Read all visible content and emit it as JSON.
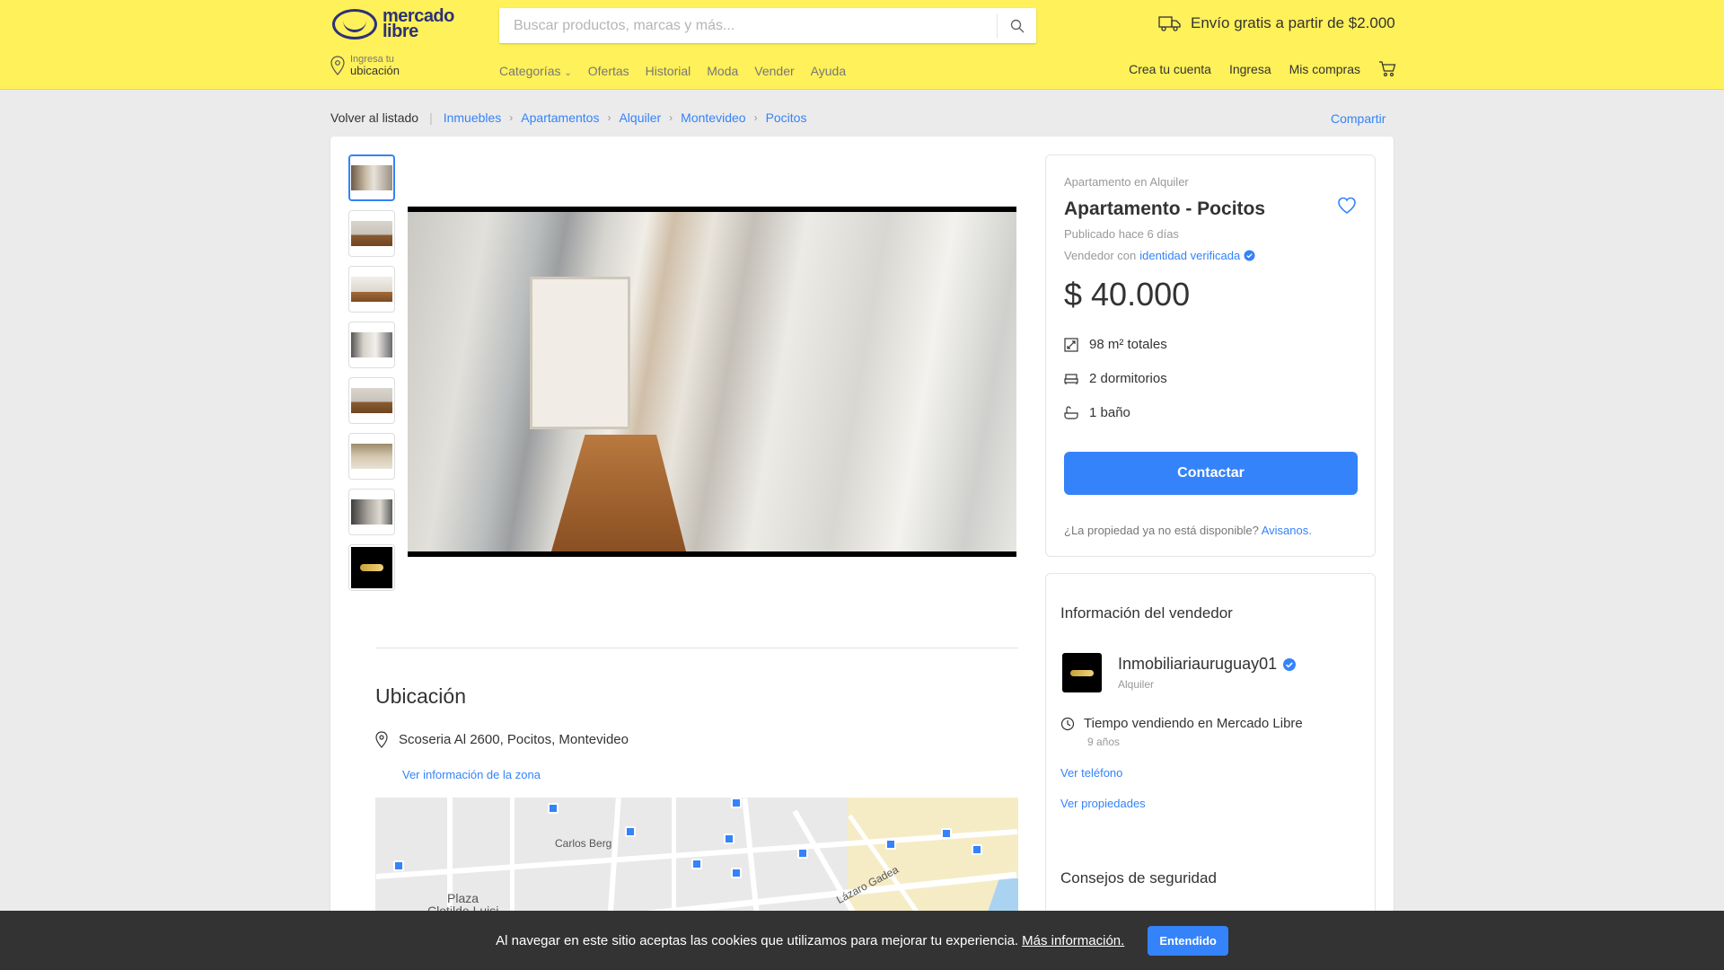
{
  "header": {
    "logo_line1": "mercado",
    "logo_line2": "libre",
    "search_placeholder": "Buscar productos, marcas y más...",
    "shipping": "Envío gratis a partir de $2.000",
    "location_small": "Ingresa tu",
    "location_big": "ubicación",
    "nav": [
      "Categorías",
      "Ofertas",
      "Historial",
      "Moda",
      "Vender",
      "Ayuda"
    ],
    "user_nav": [
      "Crea tu cuenta",
      "Ingresa",
      "Mis compras"
    ],
    "brand_color": "#fff159",
    "accent_color": "#3483fa"
  },
  "breadcrumb": {
    "back": "Volver al listado",
    "items": [
      "Inmuebles",
      "Apartamentos",
      "Alquiler",
      "Montevideo",
      "Pocitos"
    ],
    "share": "Compartir"
  },
  "gallery": {
    "thumbnail_count": 8,
    "selected_index": 0
  },
  "location": {
    "title": "Ubicación",
    "address": "Scoseria Al 2600, Pocitos, Montevideo",
    "zone_link": "Ver información de la zona",
    "map_labels": [
      "Carlos Berg",
      "Plaza",
      "Clotilde Luisi",
      "Lázaro Gadea"
    ]
  },
  "listing": {
    "subtitle": "Apartamento en Alquiler",
    "title": "Apartamento - Pocitos",
    "published": "Publicado hace 6 días",
    "seller_prefix": "Vendedor con",
    "seller_link": "identidad verificada",
    "price": "$ 40.000",
    "features": [
      {
        "icon": "area-icon",
        "label": "98 m² totales"
      },
      {
        "icon": "bed-icon",
        "label": "2 dormitorios"
      },
      {
        "icon": "bath-icon",
        "label": "1 baño"
      }
    ],
    "contact_button": "Contactar",
    "availability_q": "¿La propiedad ya no está disponible?",
    "availability_link": "Avisanos."
  },
  "seller": {
    "title": "Información del vendedor",
    "name": "Inmobiliariauruguay01",
    "role": "Alquiler",
    "time_label": "Tiempo vendiendo en Mercado Libre",
    "years": "9 años",
    "phone_link": "Ver teléfono",
    "props_link": "Ver propiedades"
  },
  "safety": {
    "title": "Consejos de seguridad"
  },
  "cookie": {
    "text": "Al navegar en este sitio aceptas las cookies que utilizamos para mejorar tu experiencia.",
    "link": "Más información.",
    "button": "Entendido"
  }
}
